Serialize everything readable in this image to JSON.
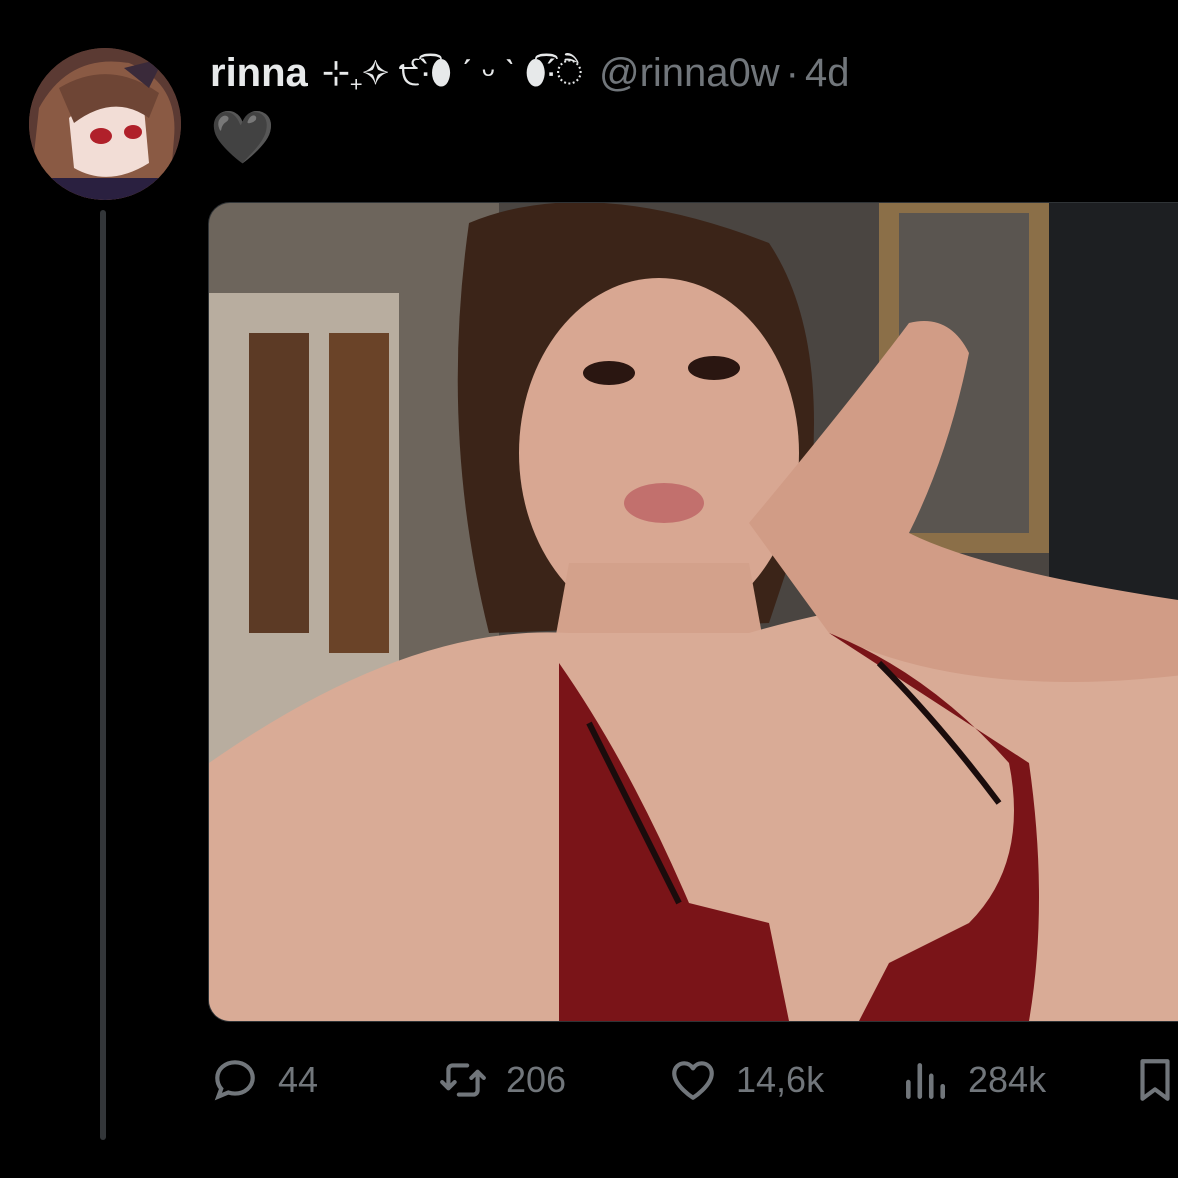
{
  "tweet": {
    "display_name": "rinna",
    "name_decoration": "⊹₊✧ ੯‧̀͡⬮ ˊ ᵕ ˋ ⬮͡‧́ੈ",
    "handle": "@rinna0w",
    "separator": "·",
    "time": "4d",
    "text": "🖤"
  },
  "actions": {
    "replies": "44",
    "retweets": "206",
    "likes": "14,6k",
    "views": "284k"
  },
  "icons": {
    "reply": "reply-icon",
    "retweet": "retweet-icon",
    "like": "heart-icon",
    "views": "views-icon",
    "bookmark": "bookmark-icon"
  },
  "colors": {
    "background": "#000000",
    "primary_text": "#e7e9ea",
    "secondary_text": "#71767b",
    "thread_line": "#333639"
  }
}
